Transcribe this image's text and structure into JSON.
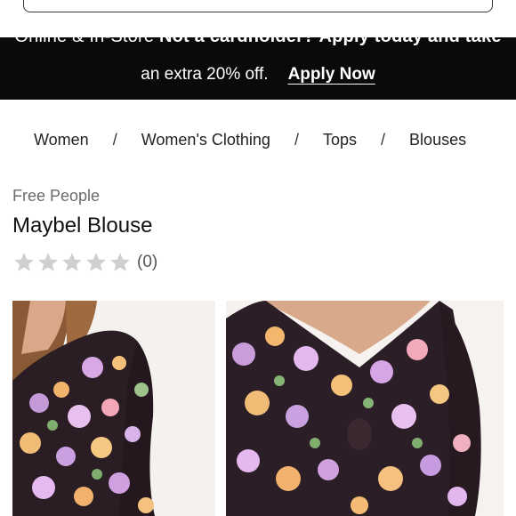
{
  "search": {
    "icon": "search-icon"
  },
  "banner": {
    "line1_pre": "Online & In-Store",
    "line1_bold": "Not a cardholder? Apply today and take",
    "line2_text": "an extra 20% off.",
    "cta": "Apply Now",
    "background": "#0a0a0a",
    "text_color": "#ffffff"
  },
  "breadcrumb": {
    "items": [
      "Women",
      "Women's Clothing",
      "Tops",
      "Blouses"
    ],
    "separator": "/"
  },
  "product": {
    "brand": "Free People",
    "title": "Maybel Blouse",
    "rating_value": 0,
    "rating_max": 5,
    "review_count": "(0)",
    "star_color": "#cfcfcf"
  },
  "images": [
    {
      "name": "model-front-view"
    },
    {
      "name": "blouse-detail-view"
    }
  ]
}
